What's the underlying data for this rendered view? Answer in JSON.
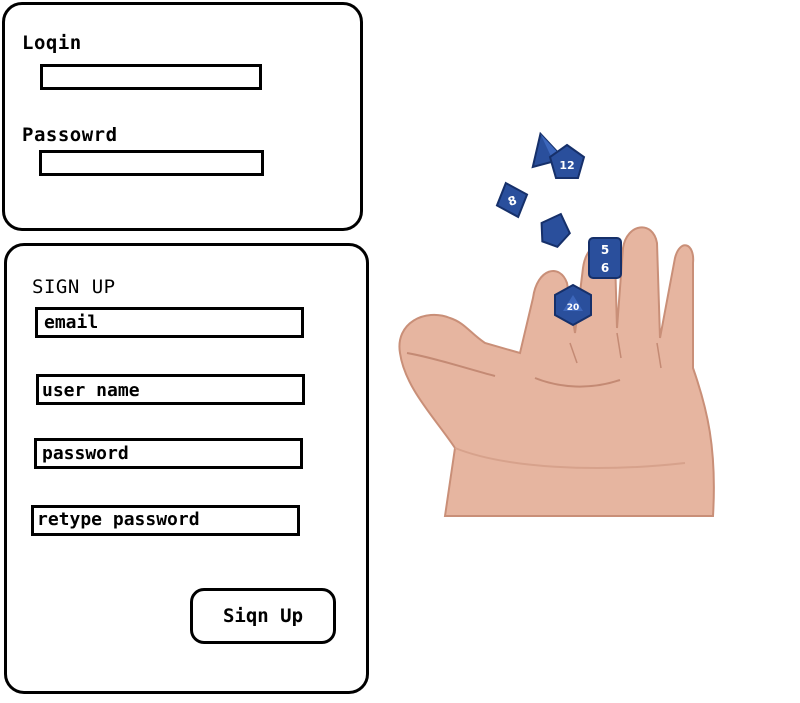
{
  "login": {
    "login_label": "Loqin",
    "password_label": "Passowrd"
  },
  "signup": {
    "title": "SIGN UP",
    "email_placeholder": "email",
    "username_placeholder": "user name",
    "password_placeholder": "password",
    "retype_placeholder": "retype password",
    "button_label": "Siqn Up"
  },
  "image": {
    "subject": "hand-tossing-blue-dice",
    "dice_color": "#2a4f9c",
    "skin_color": "#e8b9a4",
    "dice_numbers": [
      "8",
      "12",
      "5",
      "6",
      "20"
    ]
  }
}
